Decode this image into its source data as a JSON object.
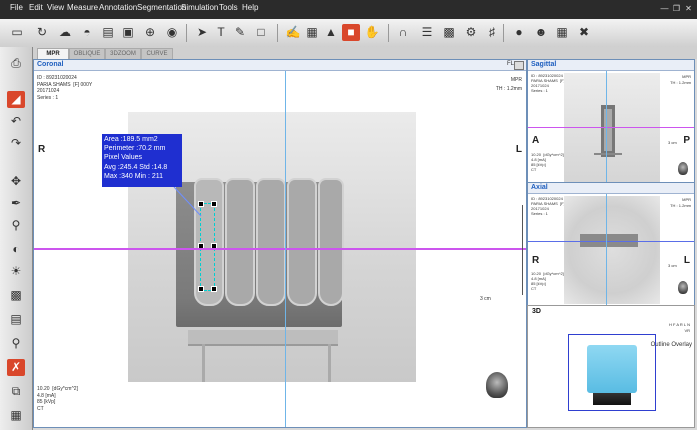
{
  "menu": [
    "File",
    "Edit",
    "View",
    "Measure",
    "Annotation",
    "Segmentation",
    "Simulation",
    "Tools",
    "Help"
  ],
  "toolbar_icons": [
    "window-level-icon",
    "rotate-icon",
    "cloud-icon",
    "3d-icon",
    "image-icon",
    "crop-icon",
    "globe-icon",
    "lock-icon",
    "pointer-icon",
    "text-icon",
    "ruler-icon",
    "pencil-icon",
    "rectangle-roi-icon",
    "edit-icon",
    "image-edit-icon",
    "chart-icon",
    "color-icon",
    "hand-icon",
    "curve-icon",
    "spine-icon",
    "histogram-icon",
    "settings-icon",
    "tube-icon",
    "camera-icon",
    "person-icon",
    "layout-icon",
    "tools-icon"
  ],
  "tabs": [
    "MPR",
    "OBLIQUE",
    "3DZOOM",
    "CURVE"
  ],
  "coronal": {
    "title": "Coronal",
    "patient_info": "ID : 89231020024\nPARIA SHAMS  [F] 000Y\n20171024\nSeries : 1",
    "mpr": "MPR",
    "thickness": "TH : 1.2mm",
    "left_label": "R",
    "right_label": "L",
    "scale_label": "3 cm",
    "bottom_info": "10.20  [dGy*cm^2]\n4.8 [mA]\n85 [kVp]\nCT",
    "header_controls": "FL"
  },
  "measurement": {
    "area": "Area :189.5  mm2",
    "perimeter": "Perimeter :70.2 mm",
    "pixel_values": "Pixel Values",
    "avg": "Avg :245.4 Std :14.8",
    "max": "Max :340  Min : 211"
  },
  "sagittal": {
    "title": "Sagittal",
    "patient_info": "ID : 89231020024\nPARIA SHAMS  [F] 000Y\n20171024\nSeries : 1",
    "mpr": "MPR",
    "thickness": "TH : 1.2mm",
    "left_label": "A",
    "right_label": "P",
    "scale_label": "3 cm",
    "bottom_info": "10.20  [dGy*cm^2]\n4.8 [mA]\n85 [kVp]\nCT"
  },
  "axial": {
    "title": "Axial",
    "patient_info": "ID : 89231020024\nPARIA SHAMS  [F] 000Y\n20171024\nSeries : 1",
    "mpr": "MPR",
    "thickness": "TH : 1.2mm",
    "left_label": "R",
    "right_label": "L",
    "scale_label": "3 cm",
    "bottom_info": "10.20  [dGy*cm^2]\n4.8 [mA]\n85 [kVp]\nCT"
  },
  "view3d": {
    "title": "3D",
    "orientation": "H F A R L N",
    "orientation_sub": "VR",
    "outline_overlay": "Outline Overlay"
  },
  "colors": {
    "accent_blue": "#1f5fbf",
    "measure_box": "#1f2fd0",
    "crosshair_h": "#cc55ee",
    "crosshair_v": "#6fb5e8",
    "active_tool": "#d9472b"
  }
}
